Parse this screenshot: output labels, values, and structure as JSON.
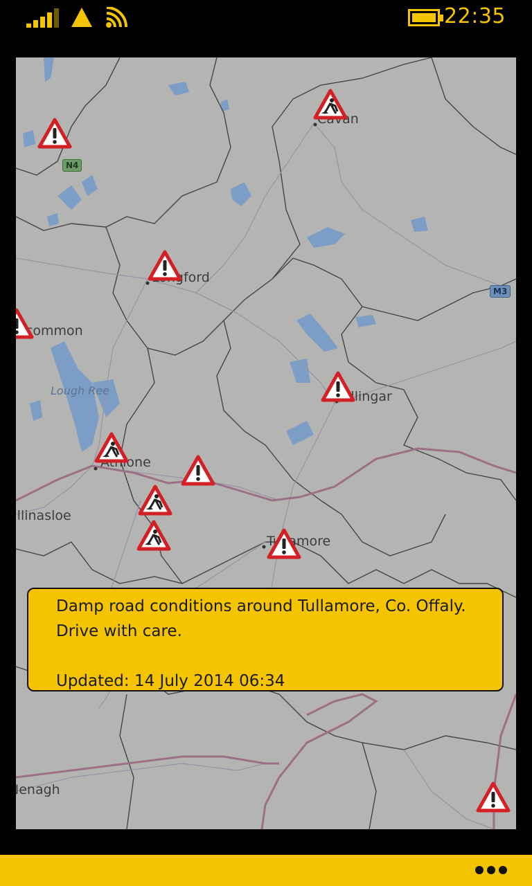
{
  "status_bar": {
    "time": "22:35",
    "icons": [
      "signal-strength-icon",
      "warning-icon",
      "wifi-icon",
      "battery-icon"
    ],
    "accent": "#f5c400"
  },
  "map": {
    "places": [
      {
        "name": "cavan-label",
        "text": "Cavan"
      },
      {
        "name": "longford-label",
        "text": "Longford"
      },
      {
        "name": "roscommon-label",
        "text": "Roscommon"
      },
      {
        "name": "lough-ree-label",
        "text": "Lough Ree"
      },
      {
        "name": "mullingar-label",
        "text": "Mullingar"
      },
      {
        "name": "athlone-label",
        "text": "Athlone"
      },
      {
        "name": "ballinasloe-label",
        "text": "Ballinasloe"
      },
      {
        "name": "tullamore-label",
        "text": "Tullamore"
      },
      {
        "name": "nenagh-label",
        "text": "Nenagh"
      }
    ],
    "road_shields": {
      "n4": "N4",
      "m3": "M3"
    },
    "marker_types": {
      "hazard": "hazard-warning-icon",
      "roadworks": "roadworks-icon"
    },
    "colors": {
      "marker_border": "#d32026",
      "water": "#7c9dc6",
      "motorway": "#9b6f86"
    }
  },
  "info_box": {
    "message": "Damp road conditions around Tullamore, Co. Offaly.  Drive with care.",
    "updated_prefix": "Updated: ",
    "updated_date": "14 July 2014 06:34"
  },
  "app_bar": {
    "more_icon": "ellipsis-icon"
  }
}
